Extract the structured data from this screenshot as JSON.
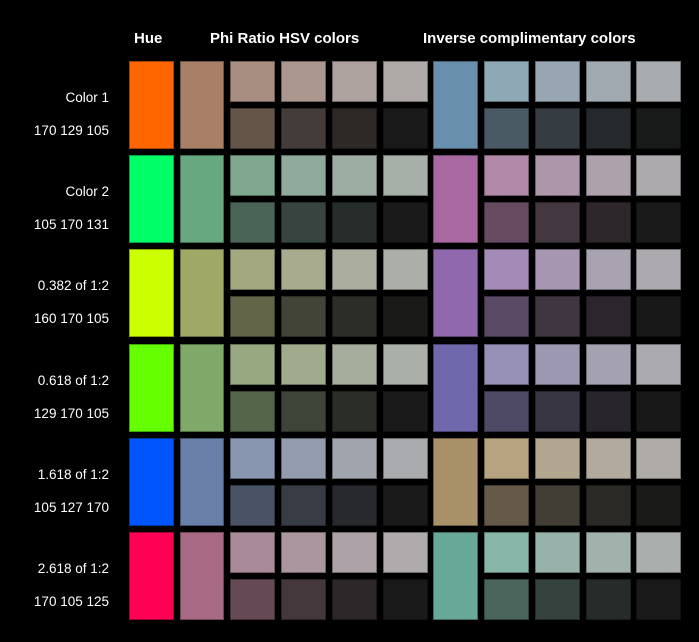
{
  "headers": {
    "hue": "Hue",
    "phi": "Phi Ratio HSV colors",
    "inverse": "Inverse complimentary colors"
  },
  "rows": [
    {
      "name": "Color 1",
      "rgb": "170 129 105",
      "hue": "#ff6600",
      "phi": "#a88068",
      "phi_top": [
        "#a88e80",
        "#ab978e",
        "#ada29d",
        "#afaaa7"
      ],
      "phi_bottom": [
        "#655548",
        "#443c38",
        "#2d2927",
        "#1a1919"
      ],
      "inv": "#6890ac",
      "inv_top": [
        "#8ea8b6",
        "#97a6b2",
        "#a2aab1",
        "#a9acaf"
      ],
      "inv_bottom": [
        "#4a5a65",
        "#363d42",
        "#26292c",
        "#181919"
      ]
    },
    {
      "name": "Color 2",
      "rgb": "105 170 131",
      "hue": "#00ff66",
      "phi": "#68a880",
      "phi_top": [
        "#80a890",
        "#8eab9c",
        "#9dada3",
        "#a7afa9"
      ],
      "phi_bottom": [
        "#4a6558",
        "#384440",
        "#272d2a",
        "#191a19"
      ],
      "inv": "#a868a0",
      "inv_top": [
        "#b08aa8",
        "#ad96aa",
        "#ada2ab",
        "#acaaad"
      ],
      "inv_bottom": [
        "#654a60",
        "#443840",
        "#2d272b",
        "#1a191a"
      ]
    },
    {
      "name": "0.382 of 1:2",
      "rgb": "160 170 105",
      "hue": "#ccff00",
      "phi": "#a0a868",
      "phi_top": [
        "#a4a880",
        "#a8ab8e",
        "#aaad9d",
        "#acafa7"
      ],
      "phi_bottom": [
        "#626548",
        "#424438",
        "#2c2d27",
        "#1a1a19"
      ],
      "inv": "#9068ac",
      "inv_top": [
        "#a48ab6",
        "#a696b2",
        "#a8a2b1",
        "#acaaaf"
      ],
      "inv_bottom": [
        "#5a4a65",
        "#3f3642",
        "#2a262c",
        "#191819"
      ]
    },
    {
      "name": "0.618 of 1:2",
      "rgb": "129 170 105",
      "hue": "#66ff00",
      "phi": "#80a868",
      "phi_top": [
        "#98a880",
        "#a0ab8e",
        "#a6ad9d",
        "#aaafa7"
      ],
      "phi_bottom": [
        "#55654a",
        "#3e4438",
        "#2b2d27",
        "#191a19"
      ],
      "inv": "#7068ac",
      "inv_top": [
        "#9690b6",
        "#9c98b2",
        "#a4a2b1",
        "#aaaaaf"
      ],
      "inv_bottom": [
        "#4e4a65",
        "#373642",
        "#28262c",
        "#181819"
      ]
    },
    {
      "name": "1.618 of 1:2",
      "rgb": "105 127 170",
      "hue": "#0055ff",
      "phi": "#6a7fa8",
      "phi_top": [
        "#8896b0",
        "#939cae",
        "#a0a4ad",
        "#a9aaae"
      ],
      "phi_bottom": [
        "#4a5265",
        "#383c44",
        "#27292d",
        "#19191a"
      ],
      "inv": "#a89068",
      "inv_top": [
        "#b6a480",
        "#b2a690",
        "#b1aa9d",
        "#afaca7"
      ],
      "inv_bottom": [
        "#65594a",
        "#423e36",
        "#2c2a26",
        "#191918"
      ]
    },
    {
      "name": "2.618 of 1:2",
      "rgb": "170 105 125",
      "hue": "#ff0055",
      "phi": "#a86a84",
      "phi_top": [
        "#a88a98",
        "#ab96a0",
        "#ada2a7",
        "#afaaac"
      ],
      "phi_bottom": [
        "#654a55",
        "#44383d",
        "#2d272a",
        "#1a1919"
      ],
      "inv": "#68a898",
      "inv_top": [
        "#88b6a8",
        "#96b2aa",
        "#a2b1ab",
        "#aaafad"
      ],
      "inv_bottom": [
        "#4a655c",
        "#36423e",
        "#262c2a",
        "#181918"
      ]
    }
  ]
}
